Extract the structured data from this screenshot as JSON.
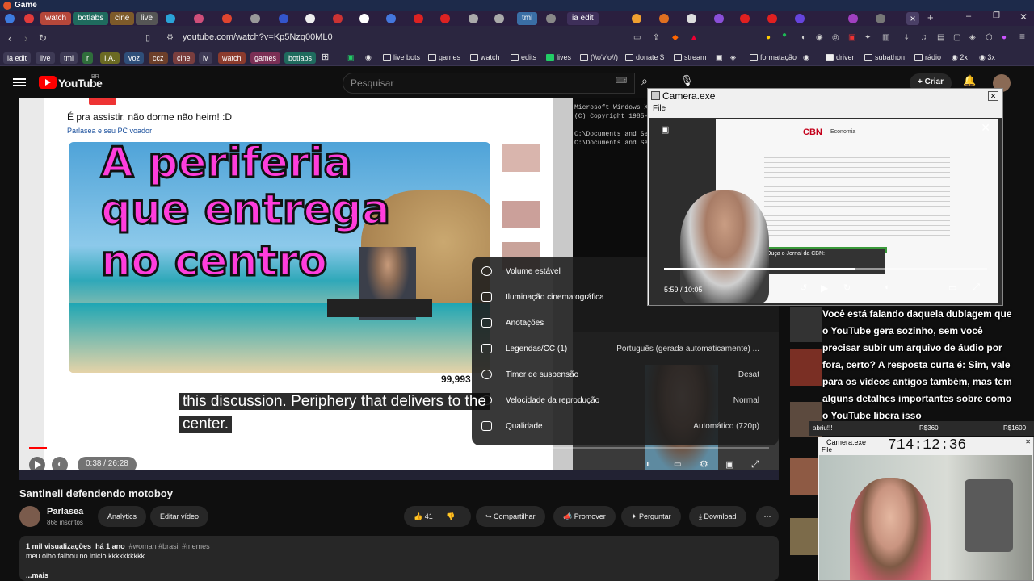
{
  "window": {
    "title": "Game"
  },
  "tabs": [
    {
      "label": "watch",
      "color": "#b5473a"
    },
    {
      "label": "botlabs",
      "color": "#1f6b5e"
    },
    {
      "label": "cine",
      "color": "#7d5a2a"
    },
    {
      "label": "live",
      "color": "#555"
    },
    {
      "label": "tml",
      "color": "#3a6ea5"
    },
    {
      "label": "ia edit",
      "color": "#2a1f3f"
    }
  ],
  "address": {
    "url": "youtube.com/watch?v=Kp5Nzq00ML0"
  },
  "bookmarks": {
    "tags": [
      {
        "label": "ia edit",
        "color": "#3e3a55"
      },
      {
        "label": "live",
        "color": "#3e3a55"
      },
      {
        "label": "tml",
        "color": "#3e3a55"
      },
      {
        "label": "r",
        "color": "#2f6e3b"
      },
      {
        "label": "I.A.",
        "color": "#6b6a23"
      },
      {
        "label": "voz",
        "color": "#2f4f7a"
      },
      {
        "label": "ccz",
        "color": "#6d3f2a"
      },
      {
        "label": "cine",
        "color": "#7a3e3e"
      },
      {
        "label": "lv",
        "color": "#3e3a55"
      },
      {
        "label": "watch",
        "color": "#8b3b2d"
      },
      {
        "label": "games",
        "color": "#7b2f55"
      },
      {
        "label": "botlabs",
        "color": "#1f6b5e"
      }
    ],
    "folders": [
      "live bots",
      "games",
      "watch",
      "edits",
      "lives",
      "(\\\\o'v'o//)",
      "donate $",
      "stream",
      "formatação",
      "driver",
      "subathon",
      "rádio",
      "2x",
      "3x"
    ]
  },
  "youtube": {
    "logo_text": "YouTube",
    "region": "BR",
    "search_placeholder": "Pesquisar",
    "create_label": "Criar"
  },
  "video": {
    "thumb_lines": [
      "A periferia",
      "que entrega",
      "no centro"
    ],
    "inner_title": "É pra assistir, não dorme não heim! :D",
    "inner_channel": "Parlasea e seu PC voador",
    "inner_count": "99,993",
    "subtitle_lines": [
      "this discussion.  Periphery that delivers to the",
      "center."
    ],
    "time": "0:38 / 26:28",
    "progress_percent": 2.4
  },
  "settings_menu": [
    {
      "label": "Volume estável",
      "value": "",
      "toggle": true
    },
    {
      "label": "Iluminação cinematográfica",
      "value": "",
      "toggle": false
    },
    {
      "label": "Anotações",
      "value": "",
      "toggle": false
    },
    {
      "label": "Legendas/CC (1)",
      "value": "Português (gerada automaticamente) ...",
      "toggle": false
    },
    {
      "label": "Timer de suspensão",
      "value": "Desat",
      "toggle": false
    },
    {
      "label": "Velocidade da reprodução",
      "value": "Normal",
      "toggle": false
    },
    {
      "label": "Qualidade",
      "value": "Automático (720p)",
      "toggle": false
    }
  ],
  "camera_window": {
    "title": "Camera.exe",
    "menu": "File",
    "time": "5:59 / 10:05",
    "doc_brand": "CBN",
    "doc_section": "Economia",
    "doc_caption": "Ouça o Jornal da CBN:"
  },
  "camera_window_small": {
    "title": "Camera.exe",
    "menu": "File",
    "clock": "714:12:36",
    "bar_items": [
      "abriu!!!",
      "R$360",
      "R$1600"
    ]
  },
  "chat_overlay": [
    "Você está falando daquela dublagem que",
    "o YouTube gera sozinho, sem você",
    "precisar subir um arquivo de áudio por",
    "fora, certo? A resposta curta é: Sim, vale",
    "para os vídeos antigos também, mas tem",
    "alguns detalhes importantes sobre como",
    "o YouTube libera isso"
  ],
  "watch_page": {
    "title": "Santineli defendendo motoboy",
    "channel": "Parlasea",
    "subscribers": "868 inscritos",
    "analytics": "Analytics",
    "edit": "Editar vídeo",
    "likes": "41",
    "share": "Compartilhar",
    "promote": "Promover",
    "ask": "Perguntar",
    "download": "Download",
    "views": "1 mil visualizações",
    "age": "há 1 ano",
    "hashtags": "#woman #brasil #memes",
    "description": "meu olho falhou no inicio kkkkkkkkkk",
    "more": "...mais"
  }
}
